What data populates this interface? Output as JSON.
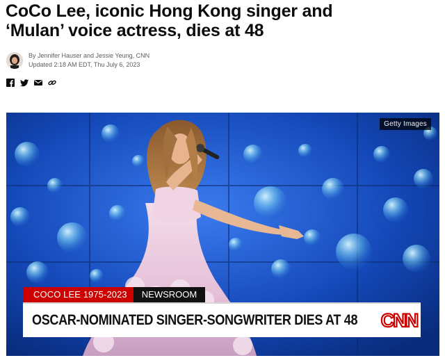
{
  "article": {
    "headline_line1": "CoCo Lee, iconic Hong Kong singer and",
    "headline_line2": "‘Mulan’ voice actress, dies at 48",
    "byline": "By Jennifer Hauser and Jessie Yeung, CNN",
    "updated": "Updated 2:18 AM EDT, Thu July 6, 2023"
  },
  "share_icons": [
    "facebook-icon",
    "twitter-icon",
    "email-icon",
    "link-icon"
  ],
  "image": {
    "credit": "Getty Images",
    "lower_third": {
      "tag_name": "COCO LEE 1975-2023",
      "tag_section": "NEWSROOM",
      "banner": "OSCAR-NOMINATED SINGER-SONGWRITER DIES AT 48",
      "logo": "CNN"
    }
  },
  "colors": {
    "cnn_red": "#cc0000",
    "headline": "#0c0c0c",
    "stage_blue": "#0d3fa8"
  }
}
